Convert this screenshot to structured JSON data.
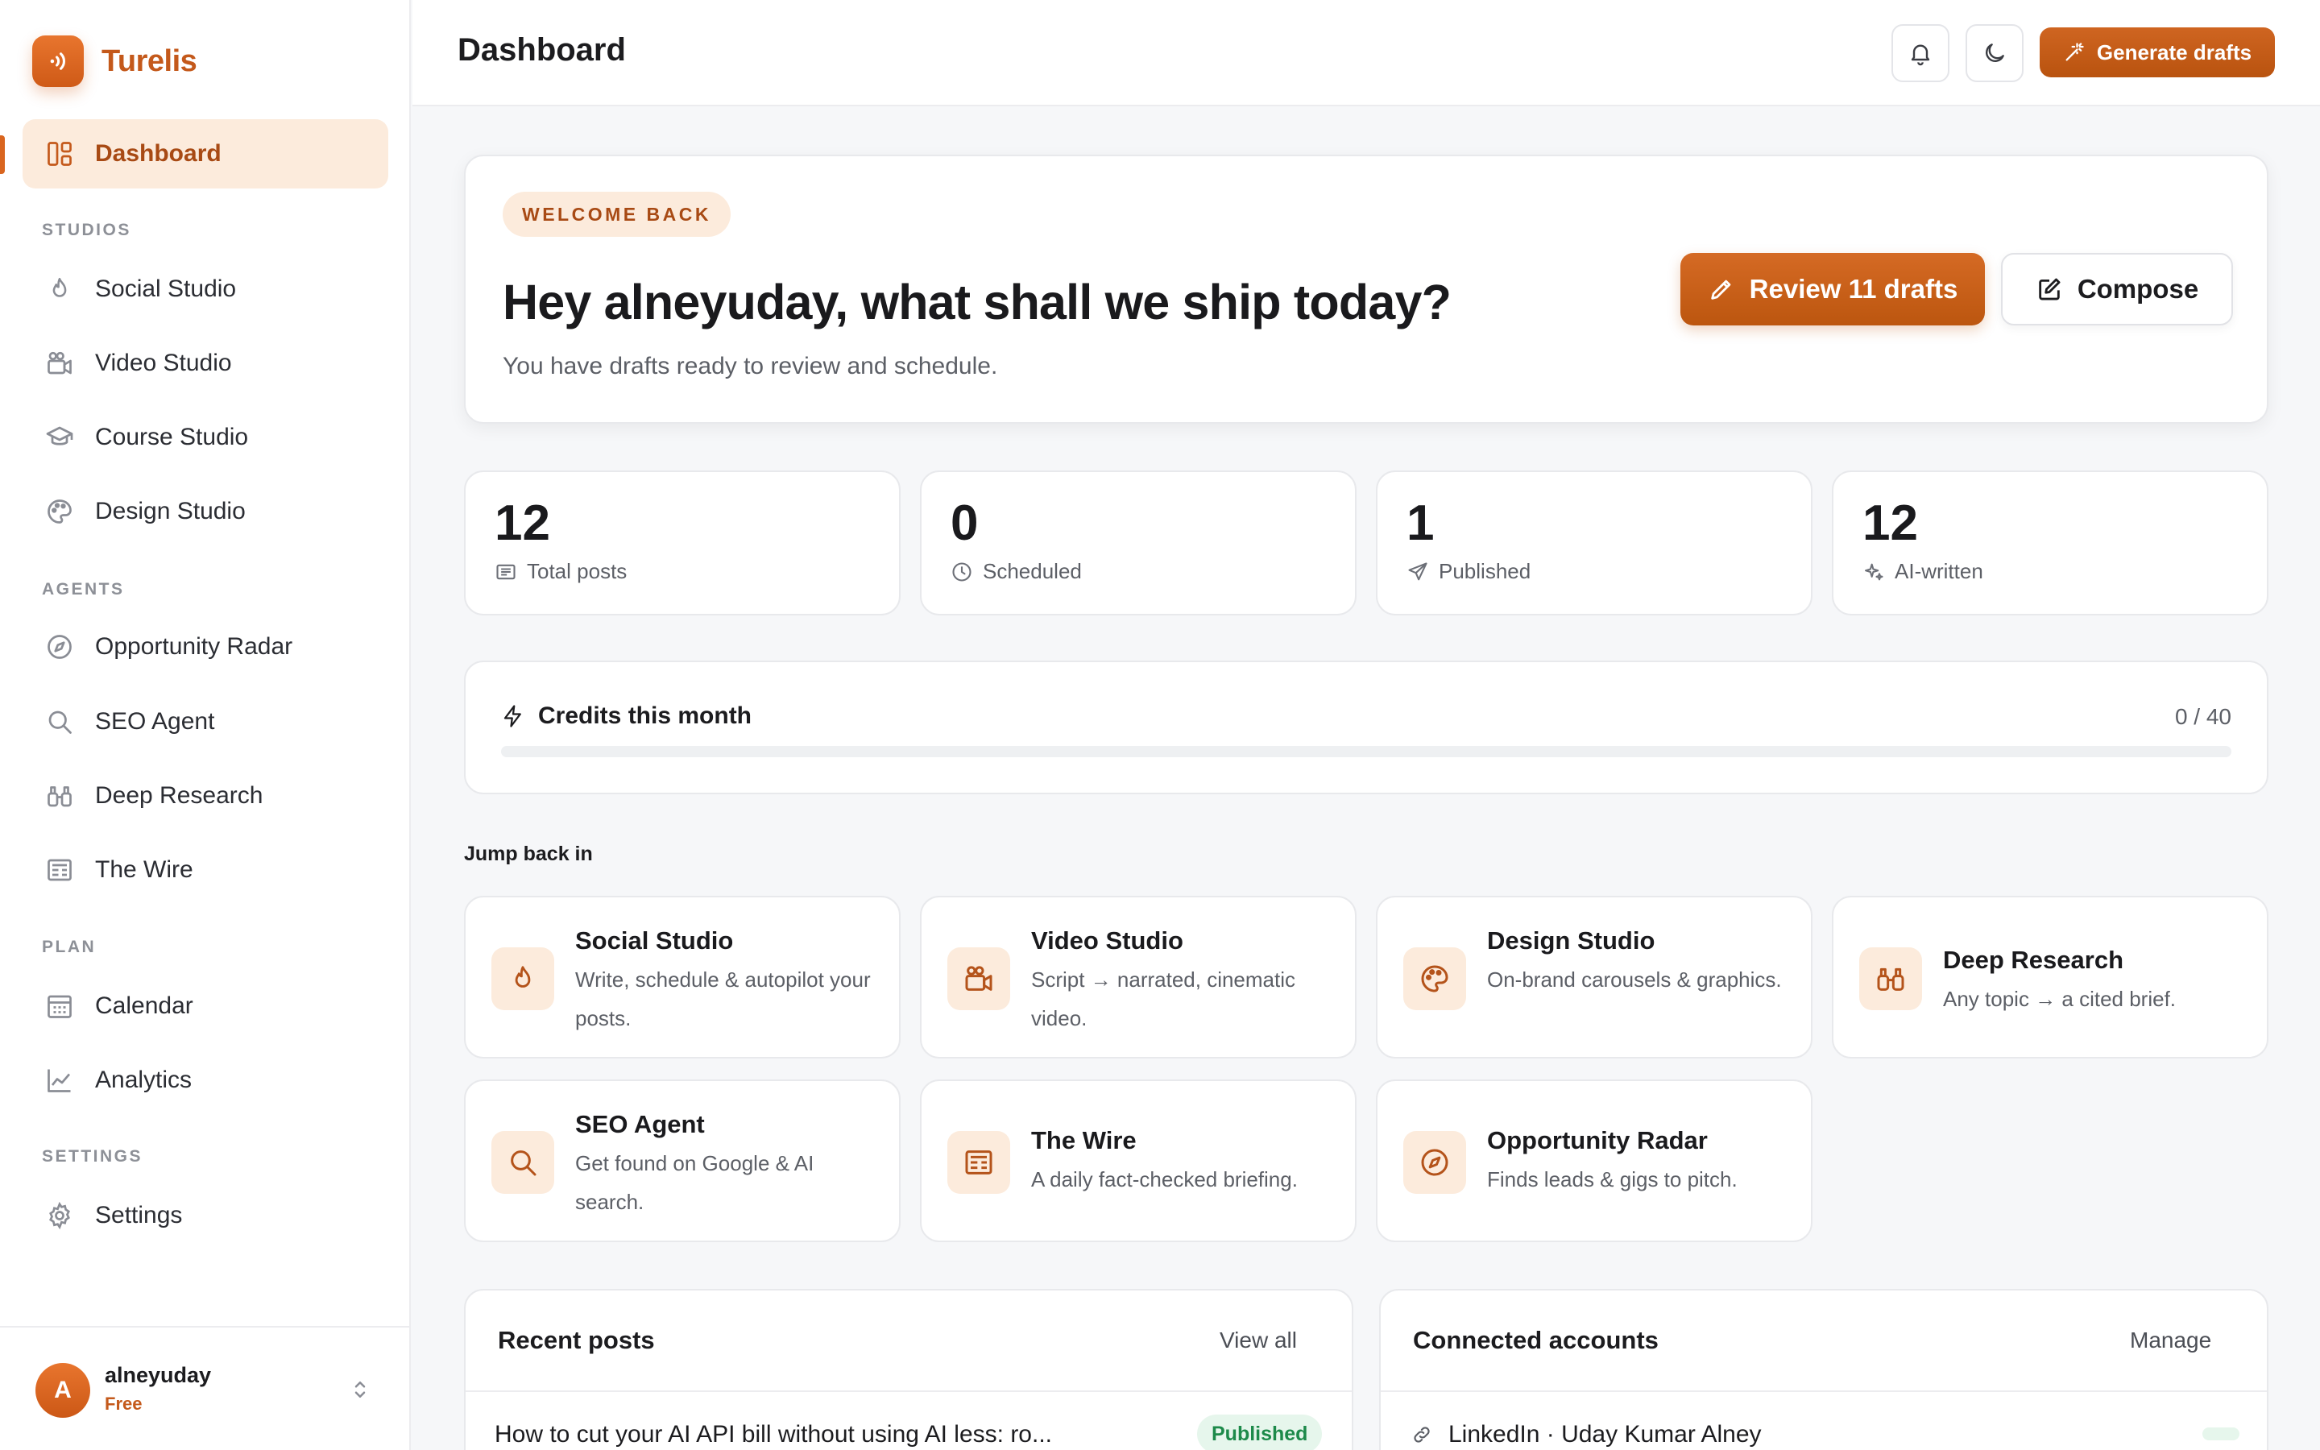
{
  "brand": {
    "name": "Turelis",
    "accent": "#d9651f"
  },
  "sidebar": {
    "dashboard_label": "Dashboard",
    "sections": {
      "studios": "STUDIOS",
      "agents": "AGENTS",
      "plan": "PLAN",
      "settings": "SETTINGS"
    },
    "items": [
      {
        "label": "Social Studio",
        "icon": "flame-icon"
      },
      {
        "label": "Video Studio",
        "icon": "video-camera-icon"
      },
      {
        "label": "Course Studio",
        "icon": "graduation-cap-icon"
      },
      {
        "label": "Design Studio",
        "icon": "palette-icon"
      },
      {
        "label": "Opportunity Radar",
        "icon": "compass-icon"
      },
      {
        "label": "SEO Agent",
        "icon": "search-icon"
      },
      {
        "label": "Deep Research",
        "icon": "binoculars-icon"
      },
      {
        "label": "The Wire",
        "icon": "newspaper-icon"
      },
      {
        "label": "Calendar",
        "icon": "calendar-icon"
      },
      {
        "label": "Analytics",
        "icon": "chart-line-icon"
      },
      {
        "label": "Settings",
        "icon": "gear-icon"
      }
    ],
    "user": {
      "name": "alneyuday",
      "plan": "Free",
      "initial": "A"
    }
  },
  "header": {
    "title": "Dashboard",
    "generate_label": "Generate drafts"
  },
  "hero": {
    "badge": "WELCOME BACK",
    "title": "Hey alneyuday, what shall we ship today?",
    "subtitle": "You have drafts ready to review and schedule.",
    "review_label": "Review 11 drafts",
    "compose_label": "Compose"
  },
  "stats": [
    {
      "value": "12",
      "label": "Total posts",
      "icon": "document-icon"
    },
    {
      "value": "0",
      "label": "Scheduled",
      "icon": "clock-icon"
    },
    {
      "value": "1",
      "label": "Published",
      "icon": "send-icon"
    },
    {
      "value": "12",
      "label": "AI-written",
      "icon": "sparkles-icon"
    }
  ],
  "credits": {
    "title": "Credits this month",
    "count_text": "0 / 40",
    "used": 0,
    "total": 40
  },
  "jump": {
    "title": "Jump back in",
    "tiles": [
      {
        "name": "Social Studio",
        "desc": "Write, schedule & autopilot your posts.",
        "icon": "flame-icon"
      },
      {
        "name": "Video Studio",
        "desc": "Script → narrated, cinematic video.",
        "icon": "video-camera-icon"
      },
      {
        "name": "Design Studio",
        "desc": "On-brand carousels & graphics.",
        "icon": "palette-icon"
      },
      {
        "name": "Deep Research",
        "desc": "Any topic → a cited brief.",
        "icon": "binoculars-icon"
      },
      {
        "name": "SEO Agent",
        "desc": "Get found on Google & AI search.",
        "icon": "search-icon"
      },
      {
        "name": "The Wire",
        "desc": "A daily fact-checked briefing.",
        "icon": "newspaper-icon"
      },
      {
        "name": "Opportunity Radar",
        "desc": "Finds leads & gigs to pitch.",
        "icon": "compass-icon"
      }
    ]
  },
  "recent_posts": {
    "title": "Recent posts",
    "view_all_label": "View all",
    "items": [
      {
        "title": "How to cut your AI API bill without using AI less: ro...",
        "status": "Published"
      }
    ]
  },
  "accounts": {
    "title": "Connected accounts",
    "manage_label": "Manage",
    "items": [
      {
        "label": "LinkedIn · Uday Kumar Alney",
        "icon": "link-icon"
      }
    ]
  }
}
